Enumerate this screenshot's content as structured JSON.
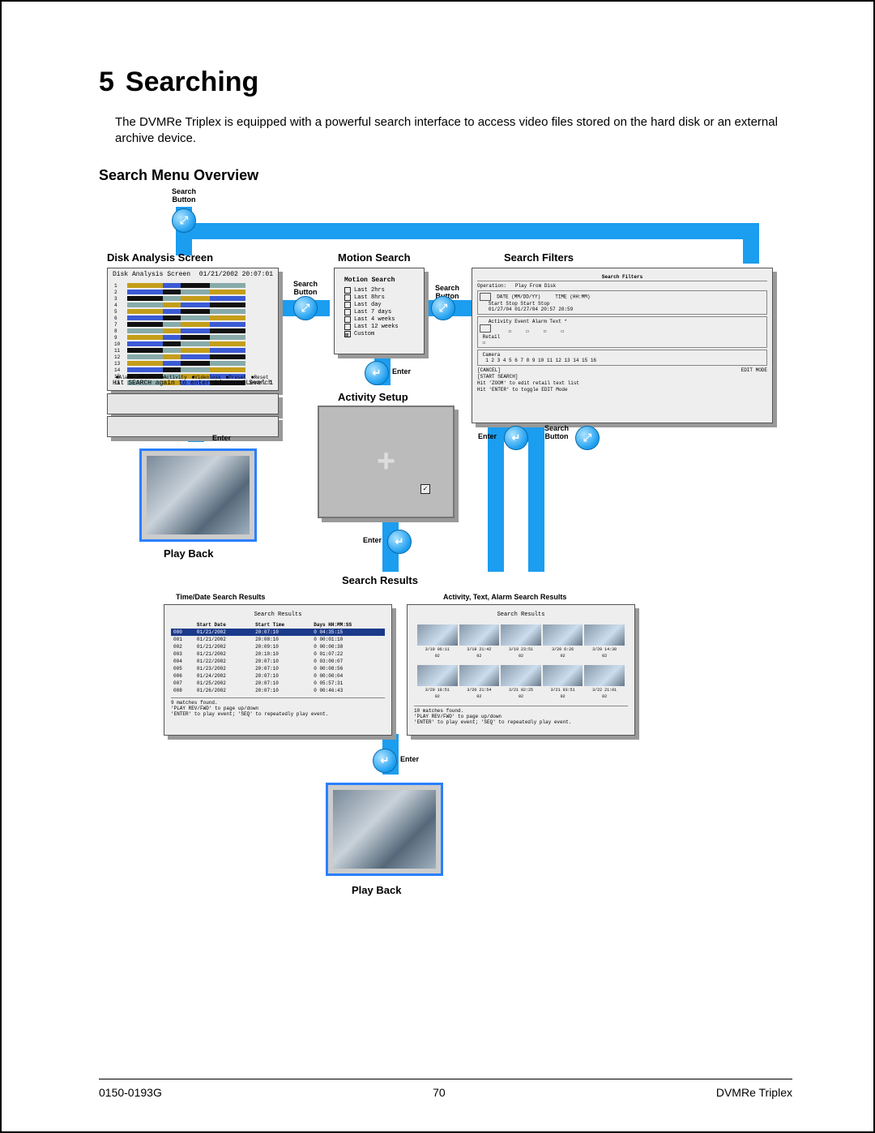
{
  "chapter_num": "5",
  "chapter_title": "Searching",
  "intro": "The DVMRe Triplex is equipped with a powerful search interface to access video files stored on the hard disk or an external archive device.",
  "section_heading": "Search Menu Overview",
  "labels": {
    "search_button": "Search Button",
    "enter": "Enter",
    "disk_analysis": "Disk Analysis Screen",
    "motion_search": "Motion Search",
    "search_filters": "Search Filters",
    "activity_setup": "Activity Setup",
    "search_results": "Search Results",
    "play_back": "Play Back",
    "time_date_results": "Time/Date Search Results",
    "alarm_results": "Activity, Text, Alarm Search Results"
  },
  "disk_analysis": {
    "title": "Disk Analysis Screen",
    "timestamp": "01/21/2002 20:07:01",
    "row_count": 16,
    "legend": [
      "Alarm",
      "Event",
      "Activity",
      "Videoloss",
      "Preset",
      "Reset"
    ],
    "hint": "Hit SEARCH again to enter Advanced Search",
    "level": "Level 1"
  },
  "motion_search": {
    "title": "Motion Search",
    "items": [
      "Last 2hrs",
      "Last 8hrs",
      "Last day",
      "Last 7 days",
      "Last 4 weeks",
      "Last 12 weeks",
      "Custom"
    ]
  },
  "search_filters": {
    "title": "Search Filters",
    "operation": "Play From Disk",
    "date_hdr": "DATE (MM/DD/YY)",
    "time_hdr": "TIME (HH:MM)",
    "cols": [
      "Start",
      "Stop",
      "Start",
      "Stop"
    ],
    "vals": [
      "01/27/04",
      "01/27/04",
      "20:57",
      "20:59"
    ],
    "flags": [
      "Activity",
      "Event",
      "Alarm",
      "Text",
      "*"
    ],
    "retail": "Retail",
    "camera": "Camera",
    "cams": "1  2  3  4  5  6  7  8  9 10 11 12 13 14 15 16",
    "cancel": "[CANCEL]",
    "start": "[START SEARCH]",
    "edit": "EDIT MODE",
    "hint1": "Hit 'ZOOM' to edit retail text list",
    "hint2": "Hit 'ENTER' to toggle EDIT Mode"
  },
  "time_results": {
    "title": "Search Results",
    "cols": [
      "",
      "Start Date",
      "Start Time",
      "Days HH:MM:SS"
    ],
    "rows": [
      [
        "000",
        "01/21/2002",
        "20:07:10",
        "0 04:35:15"
      ],
      [
        "001",
        "01/21/2002",
        "20:08:10",
        "0 00:01:10"
      ],
      [
        "002",
        "01/21/2002",
        "20:09:10",
        "0 00:00:38"
      ],
      [
        "003",
        "01/21/2002",
        "20:10:10",
        "0 01:07:22"
      ],
      [
        "004",
        "01/22/2002",
        "20:07:10",
        "0 03:00:07"
      ],
      [
        "005",
        "01/23/2002",
        "20:07:10",
        "0 00:08:56"
      ],
      [
        "006",
        "01/24/2002",
        "20:07:10",
        "0 00:00:04"
      ],
      [
        "007",
        "01/25/2002",
        "20:07:10",
        "0 05:57:31"
      ],
      [
        "008",
        "01/26/2002",
        "20:07:10",
        "0 00:46:43"
      ]
    ],
    "matches": "9   matches found.",
    "foot1": "'PLAY REV/FWD' to page up/down",
    "foot2": "'ENTER' to play event; 'SEQ' to repeatedly play event."
  },
  "alarm_results": {
    "title": "Search Results",
    "caps_r1": [
      "3/19 06:11",
      "3/19 21:42",
      "3/19 23:51",
      "3/20  6:26",
      "3/20 14:30"
    ],
    "vals_r1": [
      "02",
      "02",
      "02",
      "02",
      "02"
    ],
    "caps_r2": [
      "3/20 18:51",
      "3/20 21:54",
      "3/21 02:25",
      "3/21 03:51",
      "3/22 21:01"
    ],
    "vals_r2": [
      "02",
      "02",
      "02",
      "02",
      "02"
    ],
    "matches": "10   matches found.",
    "foot1": "'PLAY REV/FWD' to page up/down",
    "foot2": "'ENTER' to play event; 'SEQ' to repeatedly play event."
  },
  "footer": {
    "left": "0150-0193G",
    "center": "70",
    "right": "DVMRe Triplex"
  }
}
